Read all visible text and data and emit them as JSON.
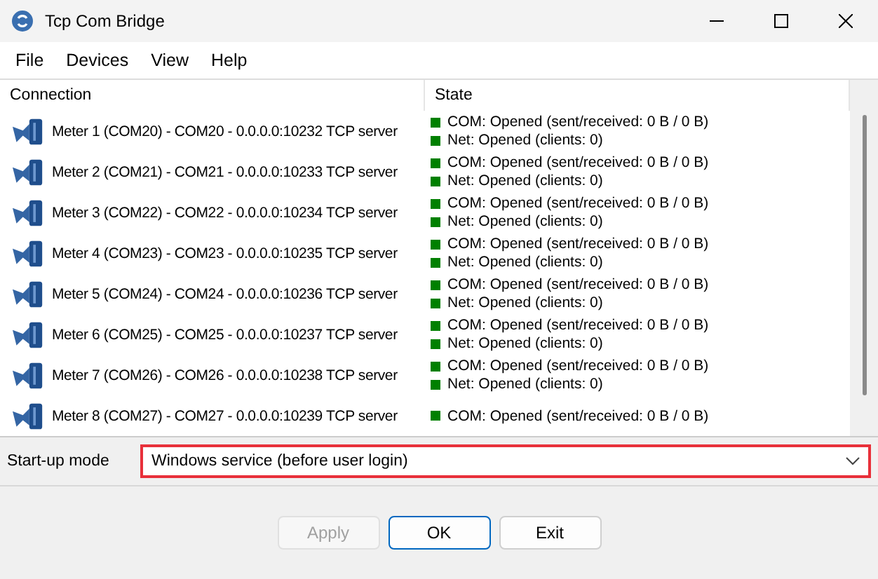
{
  "window": {
    "title": "Tcp Com Bridge"
  },
  "menu": [
    "File",
    "Devices",
    "View",
    "Help"
  ],
  "table": {
    "columns": [
      "Connection",
      "State"
    ],
    "rows": [
      {
        "connection": "Meter 1 (COM20) - COM20 - 0.0.0.0:10232 TCP server",
        "state": [
          {
            "text": "COM: Opened (sent/received: 0 B / 0 B)",
            "color": "#008000"
          },
          {
            "text": "Net: Opened (clients: 0)",
            "color": "#008000"
          }
        ]
      },
      {
        "connection": "Meter 2 (COM21) - COM21 - 0.0.0.0:10233 TCP server",
        "state": [
          {
            "text": "COM: Opened (sent/received: 0 B / 0 B)",
            "color": "#008000"
          },
          {
            "text": "Net: Opened (clients: 0)",
            "color": "#008000"
          }
        ]
      },
      {
        "connection": "Meter 3 (COM22) - COM22 - 0.0.0.0:10234 TCP server",
        "state": [
          {
            "text": "COM: Opened (sent/received: 0 B / 0 B)",
            "color": "#008000"
          },
          {
            "text": "Net: Opened (clients: 0)",
            "color": "#008000"
          }
        ]
      },
      {
        "connection": "Meter 4 (COM23) - COM23 - 0.0.0.0:10235 TCP server",
        "state": [
          {
            "text": "COM: Opened (sent/received: 0 B / 0 B)",
            "color": "#008000"
          },
          {
            "text": "Net: Opened (clients: 0)",
            "color": "#008000"
          }
        ]
      },
      {
        "connection": "Meter 5 (COM24) - COM24 - 0.0.0.0:10236 TCP server",
        "state": [
          {
            "text": "COM: Opened (sent/received: 0 B / 0 B)",
            "color": "#008000"
          },
          {
            "text": "Net: Opened (clients: 0)",
            "color": "#008000"
          }
        ]
      },
      {
        "connection": "Meter 6 (COM25) - COM25 - 0.0.0.0:10237 TCP server",
        "state": [
          {
            "text": "COM: Opened (sent/received: 0 B / 0 B)",
            "color": "#008000"
          },
          {
            "text": "Net: Opened (clients: 0)",
            "color": "#008000"
          }
        ]
      },
      {
        "connection": "Meter 7 (COM26) - COM26 - 0.0.0.0:10238 TCP server",
        "state": [
          {
            "text": "COM: Opened (sent/received: 0 B / 0 B)",
            "color": "#008000"
          },
          {
            "text": "Net: Opened (clients: 0)",
            "color": "#008000"
          }
        ]
      },
      {
        "connection": "Meter 8 (COM27) - COM27 - 0.0.0.0:10239 TCP server",
        "state": [
          {
            "text": "COM: Opened (sent/received: 0 B / 0 B)",
            "color": "#008000"
          }
        ]
      }
    ]
  },
  "startup": {
    "label": "Start-up mode",
    "value": "Windows service (before user login)"
  },
  "buttons": [
    {
      "label": "Apply",
      "disabled": true,
      "default": false
    },
    {
      "label": "OK",
      "disabled": false,
      "default": true
    },
    {
      "label": "Exit",
      "disabled": false,
      "default": false
    }
  ]
}
